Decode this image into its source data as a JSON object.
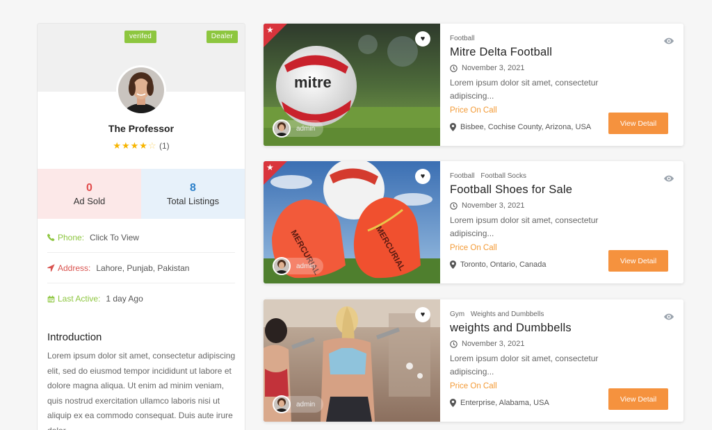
{
  "profile": {
    "badge_verified": "verifed",
    "badge_dealer": "Dealer",
    "name": "The Professor",
    "rating_count": "(1)",
    "stars_filled": 4,
    "stars_total": 5,
    "ad_sold_value": "0",
    "ad_sold_label": "Ad Sold",
    "listings_value": "8",
    "listings_label": "Total Listings",
    "phone_label": "Phone:",
    "phone_value": "Click To View",
    "address_label": "Address:",
    "address_value": "Lahore, Punjab, Pakistan",
    "active_label": "Last Active:",
    "active_value": "1 day Ago",
    "intro_title": "Introduction",
    "intro_text": "Lorem ipsum dolor sit amet, consectetur adipiscing elit, sed do eiusmod tempor incididunt ut labore et dolore magna aliqua. Ut enim ad minim veniam, quis nostrud exercitation ullamco laboris nisi ut aliquip ex ea commodo consequat. Duis aute irure dolor"
  },
  "listings": [
    {
      "categories": [
        "Football"
      ],
      "title": "Mitre Delta Football",
      "date": "November 3, 2021",
      "description": "Lorem ipsum dolor sit amet, consectetur adipiscing...",
      "price": "Price On Call",
      "location": "Bisbee, Cochise County, Arizona, USA",
      "owner": "admin",
      "button": "View Detail",
      "featured": true
    },
    {
      "categories": [
        "Football",
        "Football Socks"
      ],
      "title": "Football Shoes for Sale",
      "date": "November 3, 2021",
      "description": "Lorem ipsum dolor sit amet, consectetur adipiscing...",
      "price": "Price On Call",
      "location": "Toronto, Ontario, Canada",
      "owner": "admin",
      "button": "View Detail",
      "featured": true
    },
    {
      "categories": [
        "Gym",
        "Weights and Dumbbells"
      ],
      "title": "weights and Dumbbells",
      "date": "November 3, 2021",
      "description": "Lorem ipsum dolor sit amet, consectetur adipiscing...",
      "price": "Price On Call",
      "location": "Enterprise, Alabama, USA",
      "owner": "admin",
      "button": "View Detail",
      "featured": false
    }
  ],
  "colors": {
    "accent_orange": "#f5923e",
    "badge_green": "#8dc63f",
    "featured_red": "#d9343c"
  },
  "icons": {
    "featured": "star-icon",
    "favorite": "heart-icon",
    "views": "eye-icon",
    "date": "clock-icon",
    "location": "map-marker-icon",
    "phone": "phone-icon",
    "address": "location-arrow-icon",
    "active": "calendar-icon"
  }
}
